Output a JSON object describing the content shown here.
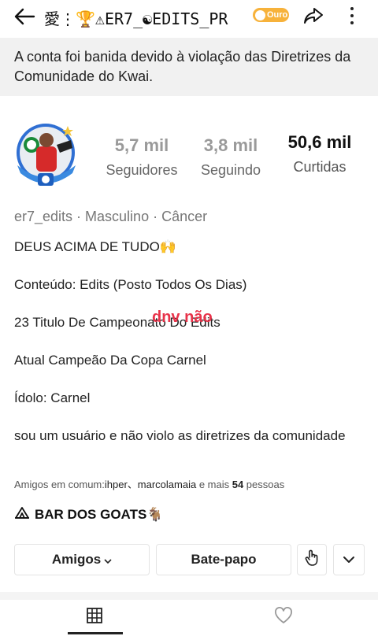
{
  "header": {
    "nickname": "愛⋮🏆⚠ER7_☯EDITS_PR",
    "level_badge": "Ouro"
  },
  "ban_notice": "A conta foi banida devido à violação das Diretrizes da Comunidade do Kwai.",
  "stats": {
    "followers": {
      "value": "5,7 mil",
      "label": "Seguidores"
    },
    "following": {
      "value": "3,8 mil",
      "label": "Seguindo"
    },
    "likes": {
      "value": "50,6 mil",
      "label": "Curtidas"
    }
  },
  "profile_meta": "er7_edits · Masculino · Câncer",
  "bio": {
    "line1": "DEUS ACIMA DE TUDO🙌",
    "line2": "Conteúdo: Edits (Posto Todos Os Dias)",
    "line3": "23 Titulo De Campeonato Do Edits",
    "line4": "Atual Campeão Da Copa Carnel",
    "line5": "Ídolo: Carnel",
    "line6": "sou um usuário e não violo as diretrizes da comunidade"
  },
  "overlay_text": "dnv não",
  "mutual_friends": {
    "prefix": "Amigos em comum:",
    "names": "ihper、marcolamaia",
    "middle": " e mais ",
    "count": "54",
    "suffix": " pessoas"
  },
  "group": {
    "name": "BAR DOS GOATS🐐"
  },
  "actions": {
    "friends_label": "Amigos",
    "chat_label": "Bate-papo"
  },
  "colors": {
    "accent_red": "#e8334a",
    "badge_gold": "#f7b23b",
    "banner_bg": "#f1f1f1"
  },
  "icons": [
    "back-arrow-icon",
    "share-icon",
    "more-vertical-icon",
    "hand-point-icon",
    "chevron-down-icon",
    "grid-icon",
    "heart-icon",
    "camp-icon"
  ]
}
